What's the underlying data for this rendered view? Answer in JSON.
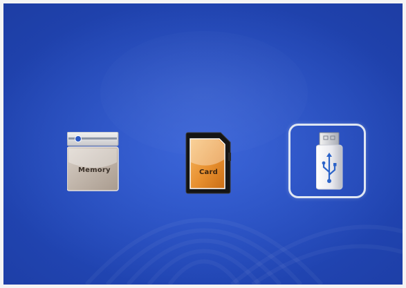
{
  "menu": {
    "options": [
      {
        "id": "memory",
        "label": "Memory",
        "icon": "memory-icon",
        "selected": false
      },
      {
        "id": "card",
        "label": "Card",
        "icon": "sd-card-icon",
        "selected": false
      },
      {
        "id": "usb",
        "label": "",
        "icon": "usb-drive-icon",
        "selected": true
      }
    ]
  },
  "colors": {
    "background": "#1e3fa7",
    "selection_frame": "#dfe6f2",
    "card_orange": "#e8902f",
    "memory_grey": "#bdb2a8",
    "usb_symbol": "#2b63c9"
  }
}
